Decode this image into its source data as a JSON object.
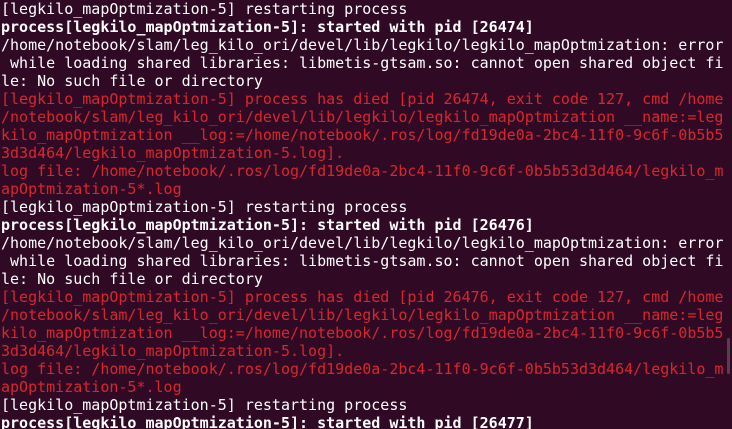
{
  "terminal": {
    "lines": [
      {
        "text": "[legkilo_mapOptmization-5] restarting process",
        "style": "normal"
      },
      {
        "text": "process[legkilo_mapOptmization-5]: started with pid [26474]",
        "style": "bold"
      },
      {
        "text": "/home/notebook/slam/leg_kilo_ori/devel/lib/legkilo/legkilo_mapOptmization: error",
        "style": "normal"
      },
      {
        "text": " while loading shared libraries: libmetis-gtsam.so: cannot open shared object fi",
        "style": "normal"
      },
      {
        "text": "le: No such file or directory",
        "style": "normal"
      },
      {
        "text": "[legkilo_mapOptmization-5] process has died [pid 26474, exit code 127, cmd /home",
        "style": "error"
      },
      {
        "text": "/notebook/slam/leg_kilo_ori/devel/lib/legkilo/legkilo_mapOptmization __name:=leg",
        "style": "error"
      },
      {
        "text": "kilo_mapOptmization __log:=/home/notebook/.ros/log/fd19de0a-2bc4-11f0-9c6f-0b5b5",
        "style": "error"
      },
      {
        "text": "3d3d464/legkilo_mapOptmization-5.log].",
        "style": "error"
      },
      {
        "text": "log file: /home/notebook/.ros/log/fd19de0a-2bc4-11f0-9c6f-0b5b53d3d464/legkilo_m",
        "style": "error"
      },
      {
        "text": "apOptmization-5*.log",
        "style": "error"
      },
      {
        "text": "[legkilo_mapOptmization-5] restarting process",
        "style": "normal"
      },
      {
        "text": "process[legkilo_mapOptmization-5]: started with pid [26476]",
        "style": "bold"
      },
      {
        "text": "/home/notebook/slam/leg_kilo_ori/devel/lib/legkilo/legkilo_mapOptmization: error",
        "style": "normal"
      },
      {
        "text": " while loading shared libraries: libmetis-gtsam.so: cannot open shared object fi",
        "style": "normal"
      },
      {
        "text": "le: No such file or directory",
        "style": "normal"
      },
      {
        "text": "[legkilo_mapOptmization-5] process has died [pid 26476, exit code 127, cmd /home",
        "style": "error"
      },
      {
        "text": "/notebook/slam/leg_kilo_ori/devel/lib/legkilo/legkilo_mapOptmization __name:=leg",
        "style": "error"
      },
      {
        "text": "kilo_mapOptmization __log:=/home/notebook/.ros/log/fd19de0a-2bc4-11f0-9c6f-0b5b5",
        "style": "error"
      },
      {
        "text": "3d3d464/legkilo_mapOptmization-5.log].",
        "style": "error"
      },
      {
        "text": "log file: /home/notebook/.ros/log/fd19de0a-2bc4-11f0-9c6f-0b5b53d3d464/legkilo_m",
        "style": "error"
      },
      {
        "text": "apOptmization-5*.log",
        "style": "error"
      },
      {
        "text": "[legkilo_mapOptmization-5] restarting process",
        "style": "normal"
      },
      {
        "text": "process[legkilo_mapOptmization-5]: started with pid [26477]",
        "style": "bold"
      }
    ]
  },
  "colors": {
    "background": "#300a24",
    "text": "#ffffff",
    "error": "#d9262d"
  }
}
